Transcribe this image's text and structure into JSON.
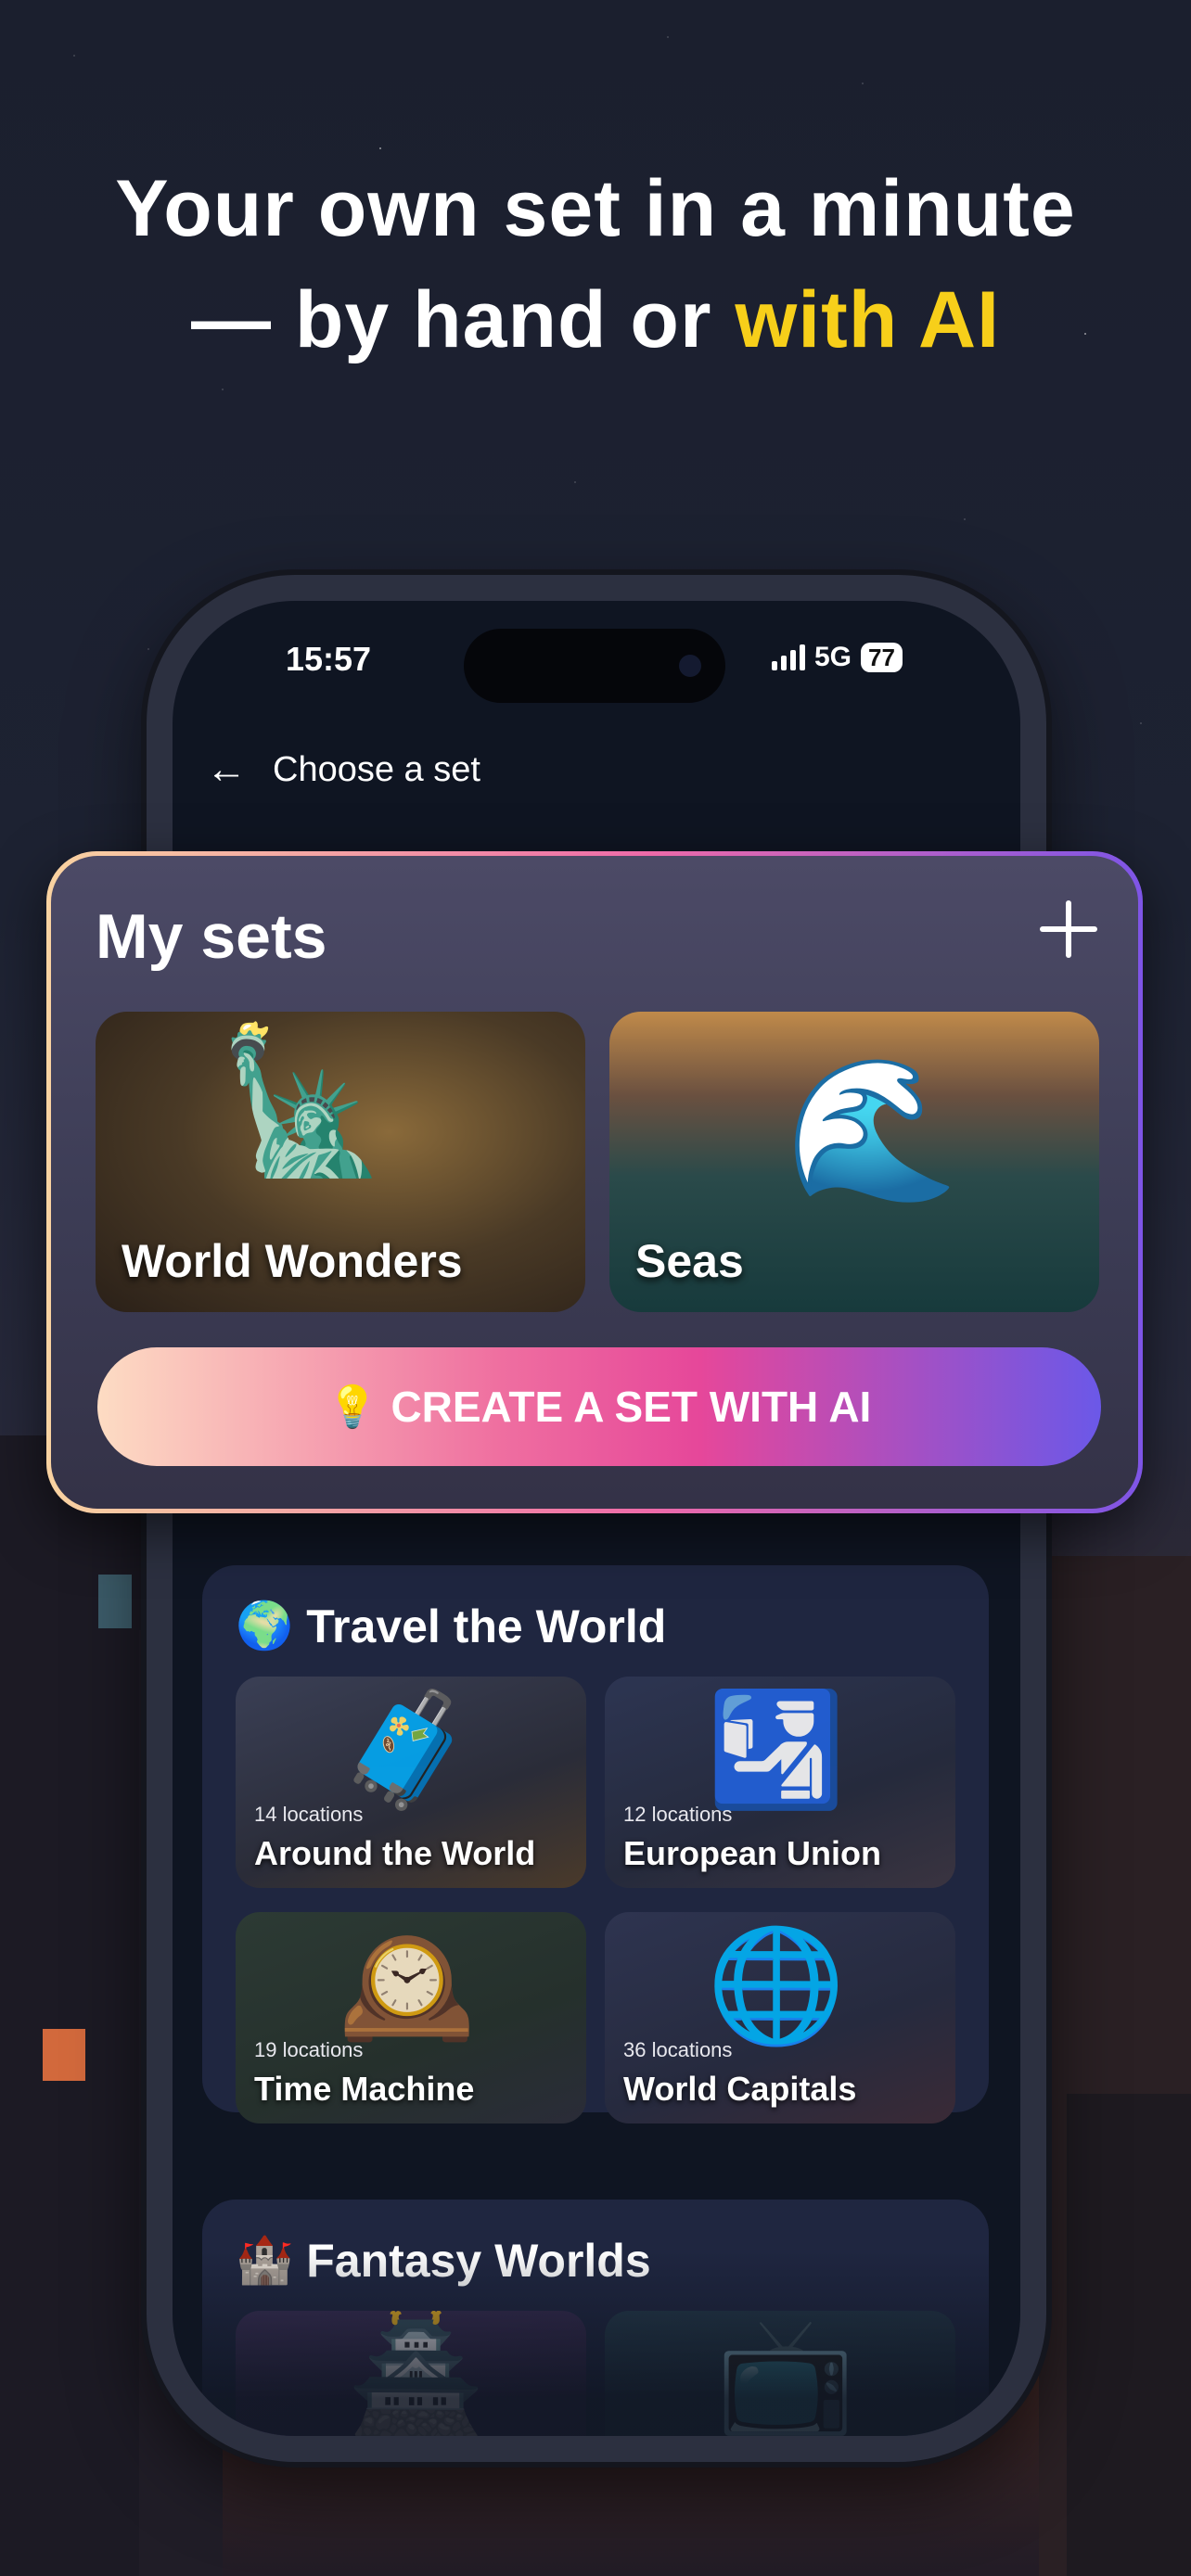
{
  "headline": {
    "line1": "Your own set in a minute",
    "line2_prefix": "— by hand or ",
    "line2_highlight": "with AI",
    "highlight_color": "#f7cf1a"
  },
  "status_bar": {
    "time": "15:57",
    "network": "5G",
    "battery": "77"
  },
  "nav": {
    "back_icon": "arrow-left-icon",
    "title": "Choose a set"
  },
  "my_sets": {
    "title": "My sets",
    "add_icon": "plus-icon",
    "cards": [
      {
        "name": "World Wonders"
      },
      {
        "name": "Seas"
      }
    ],
    "ai_button": {
      "icon": "💡",
      "label": "CREATE A SET WITH AI"
    }
  },
  "sections": [
    {
      "emoji": "🌍",
      "title": "Travel the World",
      "tiles": [
        {
          "count": "14 locations",
          "name": "Around the World"
        },
        {
          "count": "12 locations",
          "name": "European Union"
        },
        {
          "count": "19 locations",
          "name": "Time Machine"
        },
        {
          "count": "36 locations",
          "name": "World Capitals"
        }
      ]
    },
    {
      "emoji": "🏰",
      "title": "Fantasy Worlds"
    }
  ]
}
